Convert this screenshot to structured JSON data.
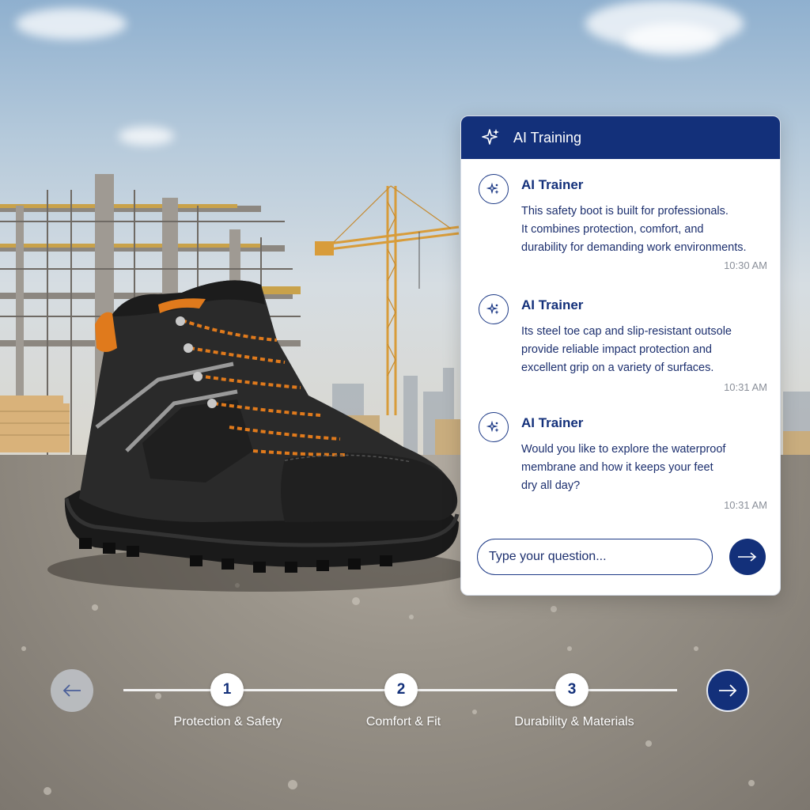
{
  "chat": {
    "title": "AI Training",
    "messages": [
      {
        "sender": "AI Trainer",
        "text": "This safety boot is built for professionals. It combines protection, comfort, and durability for demanding work environments.",
        "lines": [
          "This safety boot is built for professionals.",
          "It combines protection, comfort, and",
          "durability for demanding work environments."
        ],
        "time": "10:30 AM"
      },
      {
        "sender": "AI Trainer",
        "text": "Its steel toe cap and slip-resistant outsole provide reliable impact protection and excellent grip on a variety of surfaces.",
        "lines": [
          "Its steel toe cap and slip-resistant outsole",
          "provide reliable impact protection and",
          "excellent grip on a variety of surfaces."
        ],
        "time": "10:31 AM"
      },
      {
        "sender": "AI Trainer",
        "text": "Would you like to explore the waterproof membrane and how it keeps your feet dry all day?",
        "lines": [
          "Would you like to explore the waterproof",
          "membrane and how it keeps your feet",
          "dry all day?"
        ],
        "time": "10:31 AM"
      }
    ],
    "input_placeholder": "Type your question...",
    "icons": {
      "header": "sparkle-icon",
      "avatar": "ai-sparkle-icon",
      "send": "arrow-right-icon"
    }
  },
  "stepper": {
    "steps": [
      {
        "number": "1",
        "label": "Protection & Safety"
      },
      {
        "number": "2",
        "label": "Comfort & Fit"
      },
      {
        "number": "3",
        "label": "Durability & Materials"
      }
    ],
    "prev_icon": "arrow-left-icon",
    "next_icon": "arrow-right-icon"
  },
  "colors": {
    "primary": "#13307a",
    "accent": "#f08a24",
    "panel_bg": "#ffffff",
    "muted_text": "#8a8f99"
  }
}
